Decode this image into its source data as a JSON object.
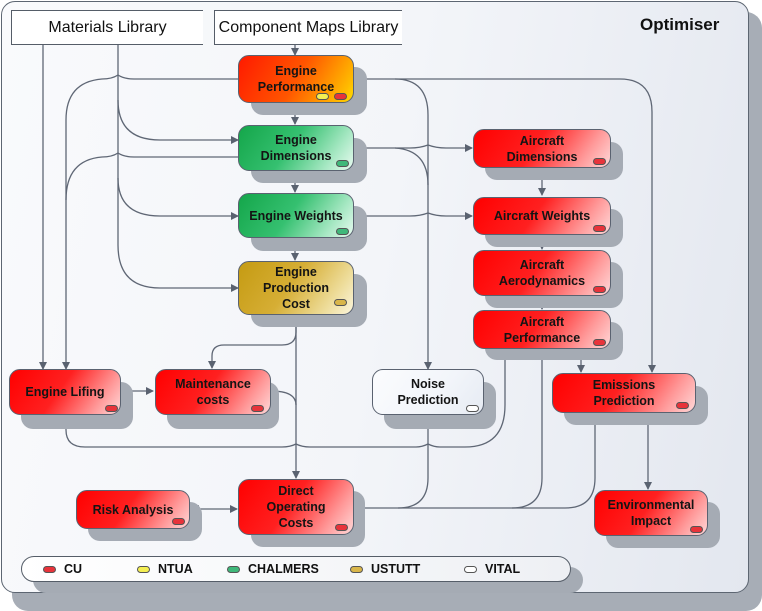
{
  "title": "Optimiser",
  "libraries": {
    "materials": "Materials Library",
    "component_maps": "Component Maps Library"
  },
  "colors": {
    "CU": "#e8333a",
    "NTUA": "#f4ef52",
    "CHALMERS": "#3fb87a",
    "USTUTT": "#d9b64a",
    "VITAL": "#ffffff"
  },
  "nodes": [
    {
      "id": "engine-performance",
      "label": "Engine Performance",
      "owners": [
        "NTUA",
        "CU"
      ]
    },
    {
      "id": "engine-dimensions",
      "label": "Engine Dimensions",
      "owners": [
        "CHALMERS"
      ]
    },
    {
      "id": "engine-weights",
      "label": "Engine Weights",
      "owners": [
        "CHALMERS"
      ]
    },
    {
      "id": "engine-production-cost",
      "label": "Engine Production Cost",
      "owners": [
        "USTUTT"
      ]
    },
    {
      "id": "aircraft-dimensions",
      "label": "Aircraft Dimensions",
      "owners": [
        "CU"
      ]
    },
    {
      "id": "aircraft-weights",
      "label": "Aircraft Weights",
      "owners": [
        "CU"
      ]
    },
    {
      "id": "aircraft-aerodynamics",
      "label": "Aircraft Aerodynamics",
      "owners": [
        "CU"
      ]
    },
    {
      "id": "aircraft-performance",
      "label": "Aircraft Performance",
      "owners": [
        "CU"
      ]
    },
    {
      "id": "engine-lifing",
      "label": "Engine Lifing",
      "owners": [
        "CU"
      ]
    },
    {
      "id": "maintenance-costs",
      "label": "Maintenance costs",
      "owners": [
        "CU"
      ]
    },
    {
      "id": "noise-prediction",
      "label": "Noise Prediction",
      "owners": [
        "VITAL"
      ]
    },
    {
      "id": "emissions-prediction",
      "label": "Emissions Prediction",
      "owners": [
        "CU"
      ]
    },
    {
      "id": "risk-analysis",
      "label": "Risk Analysis",
      "owners": [
        "CU"
      ]
    },
    {
      "id": "direct-operating-costs",
      "label": "Direct Operating Costs",
      "owners": [
        "CU"
      ]
    },
    {
      "id": "environmental-impact",
      "label": "Environmental Impact",
      "owners": [
        "CU"
      ]
    }
  ],
  "node_text": {
    "engine_performance": [
      "Engine",
      "Performance"
    ],
    "engine_dimensions": [
      "Engine",
      "Dimensions"
    ],
    "engine_weights": [
      "Engine Weights"
    ],
    "engine_production_cost": [
      "Engine",
      "Production",
      "Cost"
    ],
    "aircraft_dimensions": [
      "Aircraft",
      "Dimensions"
    ],
    "aircraft_weights": [
      "Aircraft Weights"
    ],
    "aircraft_aerodynamics": [
      "Aircraft",
      "Aerodynamics"
    ],
    "aircraft_performance": [
      "Aircraft",
      "Performance"
    ],
    "engine_lifing": [
      "Engine Lifing"
    ],
    "maintenance_costs": [
      "Maintenance",
      "costs"
    ],
    "noise_prediction": [
      "Noise",
      "Prediction"
    ],
    "emissions_prediction": [
      "Emissions",
      "Prediction"
    ],
    "risk_analysis": [
      "Risk Analysis"
    ],
    "direct_operating_costs": [
      "Direct",
      "Operating",
      "Costs"
    ],
    "environmental_impact": [
      "Environmental",
      "Impact"
    ]
  },
  "edges": [
    [
      "Component Maps Library",
      "Engine Performance"
    ],
    [
      "Materials Library",
      "Engine Lifing"
    ],
    [
      "Materials Library",
      "Engine Dimensions"
    ],
    [
      "Materials Library",
      "Engine Weights"
    ],
    [
      "Materials Library",
      "Engine Production Cost"
    ],
    [
      "Engine Performance",
      "Engine Dimensions"
    ],
    [
      "Engine Performance",
      "Engine Lifing"
    ],
    [
      "Engine Performance",
      "Noise Prediction"
    ],
    [
      "Engine Performance",
      "Emissions Prediction"
    ],
    [
      "Engine Dimensions",
      "Engine Weights"
    ],
    [
      "Engine Dimensions",
      "Aircraft Dimensions"
    ],
    [
      "Engine Dimensions",
      "Engine Lifing"
    ],
    [
      "Engine Dimensions",
      "Noise Prediction"
    ],
    [
      "Engine Weights",
      "Engine Production Cost"
    ],
    [
      "Engine Weights",
      "Aircraft Weights"
    ],
    [
      "Engine Production Cost",
      "Maintenance costs"
    ],
    [
      "Engine Production Cost",
      "Direct Operating Costs"
    ],
    [
      "Aircraft Dimensions",
      "Aircraft Weights"
    ],
    [
      "Aircraft Weights",
      "Aircraft Aerodynamics"
    ],
    [
      "Aircraft Aerodynamics",
      "Aircraft Performance"
    ],
    [
      "Aircraft Performance",
      "Emissions Prediction"
    ],
    [
      "Aircraft Performance",
      "Engine Lifing"
    ],
    [
      "Aircraft Performance",
      "Direct Operating Costs"
    ],
    [
      "Engine Lifing",
      "Maintenance costs"
    ],
    [
      "Maintenance costs",
      "Direct Operating Costs"
    ],
    [
      "Noise Prediction",
      "Direct Operating Costs"
    ],
    [
      "Emissions Prediction",
      "Direct Operating Costs"
    ],
    [
      "Emissions Prediction",
      "Environmental Impact"
    ],
    [
      "Risk Analysis",
      "Direct Operating Costs"
    ]
  ],
  "legend": [
    {
      "label": "CU",
      "color": "#e8333a"
    },
    {
      "label": "NTUA",
      "color": "#f4ef52"
    },
    {
      "label": "CHALMERS",
      "color": "#3fb87a"
    },
    {
      "label": "USTUTT",
      "color": "#d9b64a"
    },
    {
      "label": "VITAL",
      "color": "#ffffff"
    }
  ]
}
